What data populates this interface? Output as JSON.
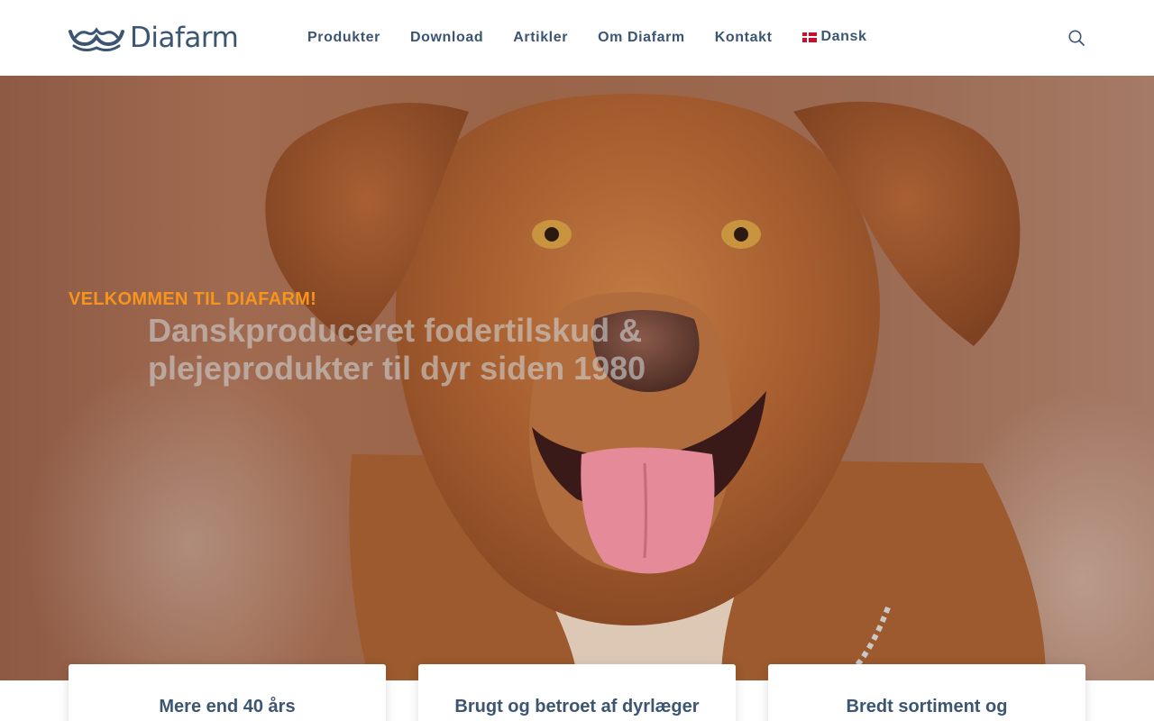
{
  "brand": {
    "name": "Diafarm",
    "colors": {
      "primary": "#3b5573",
      "accent": "#f7941d"
    }
  },
  "nav": {
    "items": [
      "Produkter",
      "Download",
      "Artikler",
      "Om Diafarm",
      "Kontakt"
    ],
    "language": {
      "label": "Dansk",
      "flag": "denmark-flag-icon"
    },
    "search_icon": "search-icon"
  },
  "hero": {
    "kicker": "VELKOMMEN TIL DIAFARM!",
    "title": "Danskproduceret fodertilskud & plejeprodukter til dyr siden 1980"
  },
  "cards": [
    {
      "title": "Mere end 40 års"
    },
    {
      "title": "Brugt og betroet af dyrlæger"
    },
    {
      "title": "Bredt sortiment og"
    }
  ]
}
